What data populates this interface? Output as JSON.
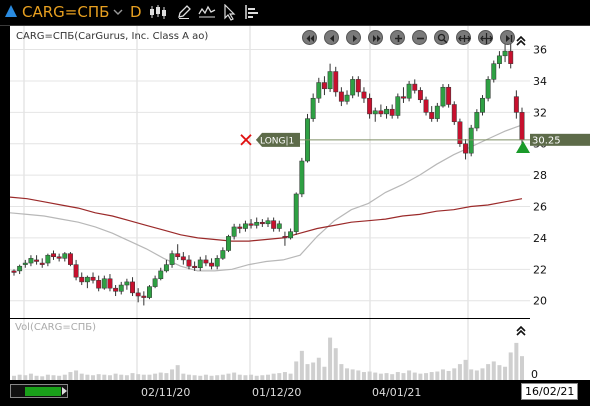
{
  "toolbar": {
    "symbol": "CARG=СПБ",
    "period": "D"
  },
  "chart": {
    "title": "CARG=СПБ(CarGurus, Inc. Class A ао)",
    "order_label": "LONG|1",
    "price_badge": "30.25",
    "volume_title": "Vol(CARG=СПБ)",
    "volume_zero": "0",
    "current_date": "16/02/21"
  },
  "chart_data": {
    "type": "candlestick",
    "title": "CARG=СПБ(CarGurus, Inc. Class A ао)",
    "y_ticks": [
      20,
      22,
      24,
      26,
      28,
      30,
      32,
      34,
      36
    ],
    "ylim": [
      18.9,
      37.5
    ],
    "x_tick_labels": [
      "02/11/20",
      "01/12/20",
      "04/01/21"
    ],
    "last_price": 30.25,
    "order": {
      "side": "LONG",
      "label": "LONG|1",
      "price": 30.25
    },
    "candles": [
      [
        21.9,
        22.0,
        21.6,
        21.8
      ],
      [
        21.9,
        22.3,
        21.7,
        22.2
      ],
      [
        22.3,
        22.6,
        22.1,
        22.4
      ],
      [
        22.4,
        22.9,
        22.2,
        22.7
      ],
      [
        22.6,
        22.9,
        22.3,
        22.5
      ],
      [
        22.4,
        22.7,
        22.1,
        22.3
      ],
      [
        22.4,
        23.0,
        22.2,
        22.9
      ],
      [
        23.0,
        23.2,
        22.6,
        22.8
      ],
      [
        22.8,
        23.0,
        22.5,
        22.7
      ],
      [
        22.7,
        23.1,
        22.5,
        23.0
      ],
      [
        23.0,
        23.1,
        22.2,
        22.3
      ],
      [
        22.3,
        22.6,
        21.3,
        21.5
      ],
      [
        21.5,
        21.8,
        21.0,
        21.2
      ],
      [
        21.2,
        21.6,
        20.8,
        21.5
      ],
      [
        21.5,
        21.8,
        21.1,
        21.3
      ],
      [
        21.3,
        21.6,
        20.6,
        20.8
      ],
      [
        20.8,
        21.6,
        20.7,
        21.4
      ],
      [
        21.4,
        21.7,
        20.6,
        20.8
      ],
      [
        20.8,
        21.0,
        20.3,
        20.6
      ],
      [
        20.6,
        21.2,
        20.4,
        21.0
      ],
      [
        21.0,
        21.4,
        20.7,
        21.2
      ],
      [
        21.2,
        21.5,
        20.3,
        20.5
      ],
      [
        20.5,
        20.8,
        19.9,
        20.3
      ],
      [
        20.3,
        20.6,
        19.7,
        20.2
      ],
      [
        20.2,
        21.0,
        20.1,
        20.9
      ],
      [
        20.9,
        21.6,
        20.8,
        21.4
      ],
      [
        21.4,
        22.1,
        21.3,
        21.9
      ],
      [
        21.9,
        22.6,
        21.8,
        22.3
      ],
      [
        22.3,
        23.2,
        22.1,
        23.0
      ],
      [
        23.0,
        23.6,
        22.6,
        22.8
      ],
      [
        22.8,
        23.1,
        22.3,
        22.6
      ],
      [
        22.6,
        22.9,
        22.0,
        22.2
      ],
      [
        22.2,
        22.5,
        21.9,
        22.1
      ],
      [
        22.1,
        22.8,
        21.9,
        22.6
      ],
      [
        22.6,
        22.9,
        22.2,
        22.4
      ],
      [
        22.4,
        22.7,
        22.0,
        22.2
      ],
      [
        22.2,
        22.9,
        22.0,
        22.7
      ],
      [
        22.7,
        23.4,
        22.6,
        23.2
      ],
      [
        23.2,
        24.2,
        23.1,
        24.1
      ],
      [
        24.1,
        24.9,
        23.9,
        24.7
      ],
      [
        24.7,
        24.9,
        24.3,
        24.6
      ],
      [
        24.6,
        25.1,
        24.4,
        24.9
      ],
      [
        24.9,
        25.2,
        24.6,
        24.8
      ],
      [
        24.8,
        25.3,
        24.6,
        25.0
      ],
      [
        25.0,
        25.2,
        24.7,
        24.9
      ],
      [
        24.9,
        25.3,
        24.7,
        25.1
      ],
      [
        25.1,
        25.3,
        24.4,
        24.6
      ],
      [
        24.6,
        25.1,
        24.4,
        24.9
      ],
      [
        24.1,
        24.4,
        23.5,
        24.0
      ],
      [
        24.0,
        24.6,
        23.9,
        24.4
      ],
      [
        24.4,
        26.9,
        24.2,
        26.8
      ],
      [
        26.8,
        29.1,
        26.6,
        28.9
      ],
      [
        28.9,
        31.9,
        28.8,
        31.6
      ],
      [
        31.6,
        33.2,
        31.4,
        32.9
      ],
      [
        32.9,
        34.2,
        32.6,
        33.9
      ],
      [
        33.9,
        34.3,
        33.1,
        33.5
      ],
      [
        33.5,
        35.1,
        33.3,
        34.6
      ],
      [
        34.6,
        34.9,
        33.0,
        33.3
      ],
      [
        33.3,
        33.6,
        32.4,
        32.7
      ],
      [
        32.7,
        33.4,
        32.5,
        33.1
      ],
      [
        33.1,
        34.3,
        32.9,
        34.1
      ],
      [
        34.1,
        34.3,
        33.0,
        33.3
      ],
      [
        33.3,
        33.6,
        32.6,
        32.9
      ],
      [
        32.9,
        33.2,
        31.6,
        31.9
      ],
      [
        31.9,
        32.3,
        31.4,
        32.1
      ],
      [
        32.1,
        32.5,
        31.7,
        31.9
      ],
      [
        31.9,
        32.4,
        31.6,
        32.2
      ],
      [
        32.2,
        32.5,
        31.6,
        31.8
      ],
      [
        31.8,
        33.2,
        31.6,
        33.0
      ],
      [
        33.0,
        33.6,
        32.6,
        32.9
      ],
      [
        32.9,
        34.0,
        32.7,
        33.8
      ],
      [
        33.8,
        34.1,
        33.2,
        33.4
      ],
      [
        33.4,
        33.6,
        32.6,
        32.8
      ],
      [
        32.8,
        33.0,
        31.8,
        32.0
      ],
      [
        32.0,
        32.4,
        31.4,
        31.6
      ],
      [
        31.6,
        32.6,
        31.4,
        32.4
      ],
      [
        32.4,
        33.8,
        32.3,
        33.6
      ],
      [
        33.6,
        33.8,
        32.3,
        32.5
      ],
      [
        32.5,
        32.7,
        31.2,
        31.4
      ],
      [
        31.4,
        31.6,
        29.8,
        30.0
      ],
      [
        30.0,
        30.3,
        29.0,
        29.4
      ],
      [
        29.4,
        31.2,
        29.2,
        31.0
      ],
      [
        31.0,
        32.2,
        30.8,
        32.0
      ],
      [
        32.0,
        33.1,
        31.8,
        32.9
      ],
      [
        32.9,
        34.3,
        32.7,
        34.1
      ],
      [
        34.1,
        35.3,
        33.9,
        35.1
      ],
      [
        35.1,
        35.9,
        34.8,
        35.6
      ],
      [
        35.6,
        36.4,
        35.2,
        35.9
      ],
      [
        35.9,
        36.9,
        34.8,
        35.1
      ],
      [
        33.0,
        33.4,
        31.6,
        32.0
      ],
      [
        32.0,
        32.3,
        30.0,
        30.25
      ]
    ],
    "sma_short_series": [
      25.6,
      25.5,
      25.4,
      25.2,
      25.0,
      24.7,
      24.3,
      23.8,
      23.3,
      22.7,
      22.2,
      21.9,
      21.9,
      22.0,
      22.3,
      22.5,
      22.6,
      22.9,
      24.1,
      25.1,
      25.8,
      26.2,
      26.9,
      27.4,
      28.0,
      28.7,
      29.3,
      29.8,
      30.3,
      30.8,
      31.2
    ],
    "sma_long_series": [
      26.6,
      26.5,
      26.3,
      26.1,
      25.9,
      25.6,
      25.4,
      25.1,
      24.8,
      24.5,
      24.2,
      24.0,
      23.9,
      23.8,
      23.8,
      23.9,
      24.0,
      24.3,
      24.6,
      24.8,
      25.0,
      25.1,
      25.2,
      25.4,
      25.5,
      25.7,
      25.8,
      26.0,
      26.1,
      26.3,
      26.5
    ],
    "volume": [
      0.08,
      0.1,
      0.09,
      0.12,
      0.08,
      0.07,
      0.1,
      0.09,
      0.08,
      0.1,
      0.15,
      0.18,
      0.12,
      0.1,
      0.09,
      0.11,
      0.1,
      0.09,
      0.12,
      0.1,
      0.09,
      0.13,
      0.11,
      0.1,
      0.1,
      0.12,
      0.14,
      0.13,
      0.2,
      0.28,
      0.12,
      0.1,
      0.09,
      0.08,
      0.1,
      0.08,
      0.09,
      0.1,
      0.12,
      0.14,
      0.1,
      0.09,
      0.1,
      0.08,
      0.09,
      0.1,
      0.12,
      0.13,
      0.15,
      0.12,
      0.35,
      0.55,
      0.3,
      0.33,
      0.42,
      0.25,
      0.8,
      0.6,
      0.3,
      0.22,
      0.2,
      0.18,
      0.15,
      0.16,
      0.14,
      0.12,
      0.13,
      0.11,
      0.15,
      0.13,
      0.18,
      0.14,
      0.12,
      0.13,
      0.15,
      0.16,
      0.2,
      0.17,
      0.22,
      0.3,
      0.38,
      0.2,
      0.18,
      0.22,
      0.3,
      0.35,
      0.28,
      0.25,
      0.52,
      0.7,
      0.45
    ]
  }
}
